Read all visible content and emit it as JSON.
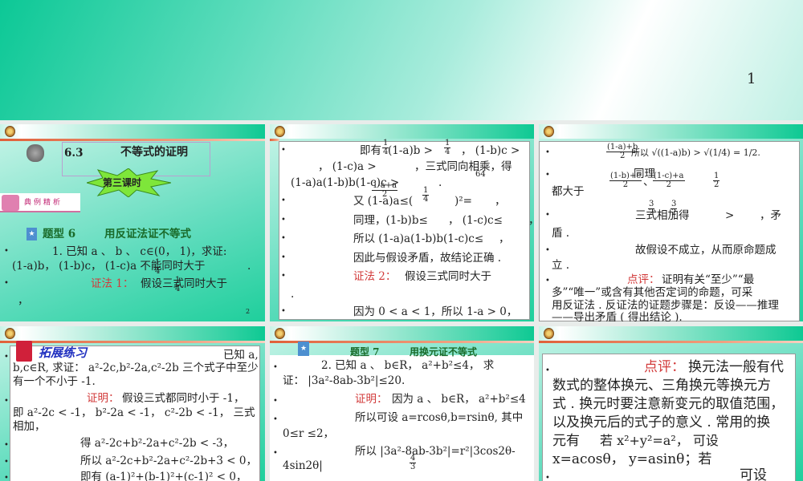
{
  "page_number": "1",
  "slide2": {
    "section": "6.3",
    "title": "不等式的证明",
    "lesson": "第三课时",
    "banner": "典例精析",
    "type_label": "题型 6",
    "type_title": "用反证法证不等式",
    "l1": "1. 已知 a 、 b 、 c∈(0， 1)，求证:",
    "l2": "(1-a)b， (1-b)c， (1-c)a 不能同时大于",
    "l2_end": ".",
    "proof_label": "证法 1：",
    "l3": "假设三式同时大于",
    "l4": "，",
    "frac_num": "1",
    "frac_den": "4",
    "slide_no": "2"
  },
  "slide3": {
    "l1a": "即有",
    "l1b": "(1-a)b >",
    "l1c": "， (1-b)c >",
    "l2": "， (1-c)a >",
    "l2b": "，三式同向相乘，得",
    "l3": "(1-a)a(1-b)b(1-c)c >",
    "l3b": ".",
    "l4": "又 (1-a)a≤(",
    "l4mid_num": "1-a+a",
    "l4mid_den": "2",
    "l4b": ")²=",
    "l4c": "，",
    "l5": "同理，(1-b)b≤",
    "l5b": "， (1-c)c≤",
    "l5c": "，",
    "l6": "所以 (1-a)a(1-b)b(1-c)c≤",
    "l6b": "，",
    "l7": "因此与假设矛盾，故结论正确 .",
    "proof_label": "证法 2：",
    "l8": "假设三式同时大于",
    "l9": ".",
    "l10": "因为 0 < a < 1，所以 1-a > 0，",
    "one": "1",
    "four": "4",
    "sixtyfour": "64"
  },
  "slide4": {
    "l1a": "(1-a)+b",
    "l1b": "2",
    "l1c": "≥",
    "l1d": "所以 √((1-a)b) > √(1/4) = 1/2.",
    "l2": "同理",
    "l2a": "(1-b)+c",
    "l2b": "、",
    "l2c": "(1-c)+a",
    "l2d": "2",
    "l3": "都大于",
    "half_num": "1",
    "half_den": "2",
    "l4": "三式相加得",
    "l4b": ">",
    "l4c": "，矛",
    "three": "3",
    "l5": "盾 .",
    "l6": "故假设不成立，从而原命题成",
    "l7": "立 .",
    "comment_label": "点评：",
    "l8": "证明有关“至少”“最",
    "l9": "多”“唯一”或含有其他否定词的命题，可采",
    "l10": "用反证法 . 反证法的证题步骤是：反设——推理",
    "l11": "——导出矛盾 ( 得出结论 )."
  },
  "slide5": {
    "heading": "拓展练习",
    "l1": "已知 a,",
    "l2": "b,c∈R, 求证： a²-2c,b²-2a,c²-2b 三个式子中至少",
    "l3": "有一个不小于 -1.",
    "proof_label": "证明：",
    "l4": "假设三式都同时小于 -1，",
    "l5": "即 a²-2c < -1， b²-2a < -1， c²-2b < -1， 三式",
    "l6": "相加，",
    "l7": "得 a²-2c+b²-2a+c²-2b < -3，",
    "l8": "所以 a²-2c+b²-2a+c²-2b+3 < 0，",
    "l9": "即有 (a-1)²+(b-1)²+(c-1)² < 0，"
  },
  "slide6": {
    "type_label": "题型 7",
    "type_title": "用换元证不等式",
    "l1": "2. 已知 a 、 b∈R， a²+b²≤4， 求",
    "l2": "证： |3a²-8ab-3b²|≤20.",
    "proof_label": "证明：",
    "l3": "因为 a 、 b∈R， a²+b²≤4",
    "l4": "所以可设 a=rcosθ,b=rsinθ, 其中",
    "l5": "0≤r ≤2，",
    "l6": "所以 |3a²-8ab-3b²|=r²|3cos2θ-",
    "l7": "4sin2θ|",
    "frac_num": "4",
    "frac_den": "3"
  },
  "slide7": {
    "comment_label": "点评：",
    "l1": "换元法一般有代",
    "l2": "数式的整体换元、三角换元等换元方",
    "l3": "式 . 换元时要注意新变元的取值范围，",
    "l4": "以及换元后的式子的意义 . 常用的换",
    "l5": "元有",
    "l5b": "若 x²+y²=a²， 可设",
    "l6": "x=acosθ， y=asinθ；若",
    "l7": "可设"
  }
}
